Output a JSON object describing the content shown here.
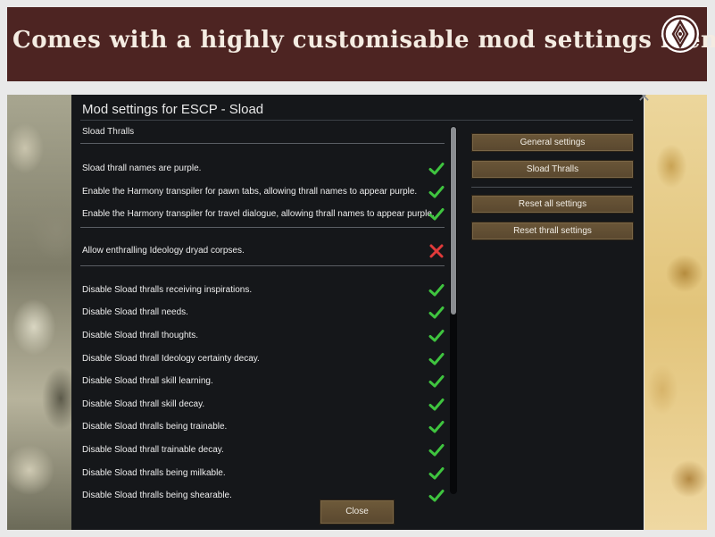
{
  "banner": {
    "title": "Comes with a highly customisable mod settings menu",
    "logo_icon": "diamond-eye-icon",
    "background_color": "#4d2422"
  },
  "dialog": {
    "title": "Mod settings for ESCP - Sload",
    "close_icon": "close-icon",
    "section_title": "Sload Thralls",
    "settings": [
      {
        "label": "Sload thrall names are purple.",
        "enabled": true
      },
      {
        "label": "Enable the Harmony transpiler for pawn tabs, allowing thrall names to appear purple.",
        "enabled": true
      },
      {
        "label": "Enable the Harmony transpiler for travel dialogue, allowing thrall names to appear purple.",
        "enabled": true
      },
      {
        "label": "Allow enthralling Ideology dryad corpses.",
        "enabled": false
      },
      {
        "label": "Disable Sload thralls receiving inspirations.",
        "enabled": true
      },
      {
        "label": "Disable Sload thrall needs.",
        "enabled": true
      },
      {
        "label": "Disable Sload thrall thoughts.",
        "enabled": true
      },
      {
        "label": "Disable Sload thrall Ideology certainty decay.",
        "enabled": true
      },
      {
        "label": "Disable Sload thrall skill learning.",
        "enabled": true
      },
      {
        "label": "Disable Sload thrall skill decay.",
        "enabled": true
      },
      {
        "label": "Disable Sload thralls being trainable.",
        "enabled": true
      },
      {
        "label": "Disable Sload thrall trainable decay.",
        "enabled": true
      },
      {
        "label": "Disable Sload thralls being milkable.",
        "enabled": true
      },
      {
        "label": "Disable Sload thralls being shearable.",
        "enabled": true
      }
    ],
    "side_buttons": {
      "general": "General settings",
      "sload_thralls": "Sload Thralls",
      "reset_all": "Reset all settings",
      "reset_thrall": "Reset thrall settings"
    },
    "close_button": "Close",
    "colors": {
      "check": "#3fc43f",
      "cross": "#e03a3a",
      "button": "#5e4b31"
    }
  }
}
